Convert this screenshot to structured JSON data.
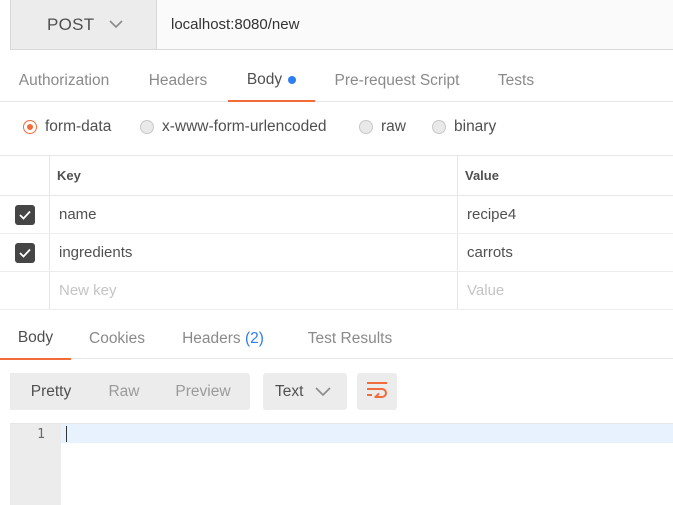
{
  "request": {
    "method": "POST",
    "url": "localhost:8080/new"
  },
  "request_tabs": [
    {
      "label": "Authorization",
      "active": false
    },
    {
      "label": "Headers",
      "active": false
    },
    {
      "label": "Body",
      "active": true
    },
    {
      "label": "Pre-request Script",
      "active": false
    },
    {
      "label": "Tests",
      "active": false
    }
  ],
  "body_types": [
    {
      "label": "form-data",
      "selected": true
    },
    {
      "label": "x-www-form-urlencoded",
      "selected": false
    },
    {
      "label": "raw",
      "selected": false
    },
    {
      "label": "binary",
      "selected": false
    }
  ],
  "params_table": {
    "headers": {
      "key": "Key",
      "value": "Value"
    },
    "rows": [
      {
        "checked": true,
        "key": "name",
        "value": "recipe4"
      },
      {
        "checked": true,
        "key": "ingredients",
        "value": "carrots"
      }
    ],
    "placeholder": {
      "key": "New key",
      "value": "Value"
    }
  },
  "response_tabs": [
    {
      "label": "Body",
      "active": true
    },
    {
      "label": "Cookies",
      "active": false
    },
    {
      "label": "Headers",
      "count": "(2)",
      "active": false
    },
    {
      "label": "Test Results",
      "active": false
    }
  ],
  "response_toolbar": {
    "views": [
      {
        "label": "Pretty",
        "active": true
      },
      {
        "label": "Raw",
        "active": false
      },
      {
        "label": "Preview",
        "active": false
      }
    ],
    "format": "Text",
    "wrap_icon": "wrap-lines-icon"
  },
  "editor": {
    "line_numbers": [
      "1"
    ]
  },
  "colors": {
    "accent": "#f26b3a",
    "link_blue": "#2f7ef2",
    "checkbox": "#454545"
  }
}
